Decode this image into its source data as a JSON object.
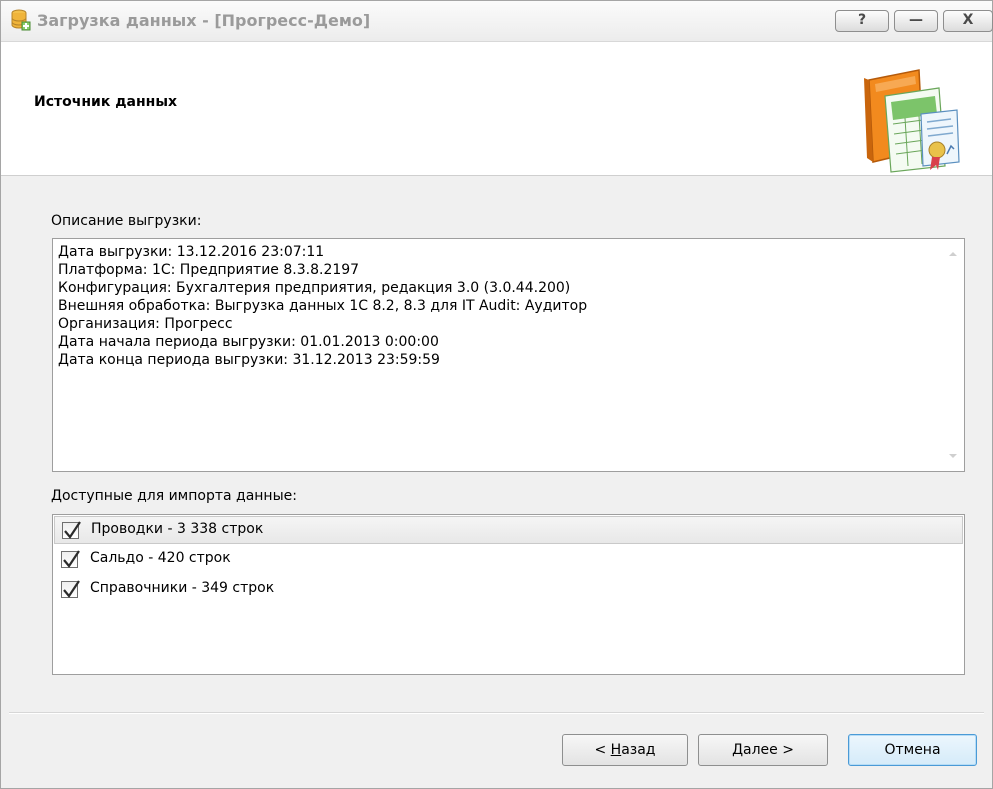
{
  "window": {
    "title": "Загрузка данных - [Прогресс-Демо]",
    "controls": {
      "help": "?",
      "minimize": "—",
      "close": "X"
    }
  },
  "header": {
    "title": "Источник данных"
  },
  "description": {
    "label": "Описание выгрузки:",
    "lines": [
      "Дата выгрузки: 13.12.2016 23:07:11",
      "Платформа: 1С: Предприятие 8.3.8.2197",
      "Конфигурация: Бухгалтерия предприятия, редакция 3.0 (3.0.44.200)",
      "Внешняя обработка: Выгрузка данных 1С 8.2, 8.3 для IT Audit: Аудитор",
      "Организация: Прогресс",
      "Дата начала периода выгрузки: 01.01.2013 0:00:00",
      "Дата конца периода выгрузки: 31.12.2013 23:59:59"
    ]
  },
  "import": {
    "label": "Доступные для импорта данные:",
    "items": [
      {
        "label": "Проводки - 3 338 строк",
        "checked": true,
        "selected": true
      },
      {
        "label": "Сальдо - 420 строк",
        "checked": true,
        "selected": false
      },
      {
        "label": "Справочники - 349 строк",
        "checked": true,
        "selected": false
      }
    ]
  },
  "buttons": {
    "back_prefix": "< ",
    "back_mnemonic": "Н",
    "back_rest": "азад",
    "next_mnemonic": "Д",
    "next_rest": "алее >",
    "cancel": "Отмена"
  },
  "colors": {
    "window_bg": "#f0f0f0",
    "title_text": "#9a9a9a",
    "cancel_border": "#4a9ad6"
  }
}
